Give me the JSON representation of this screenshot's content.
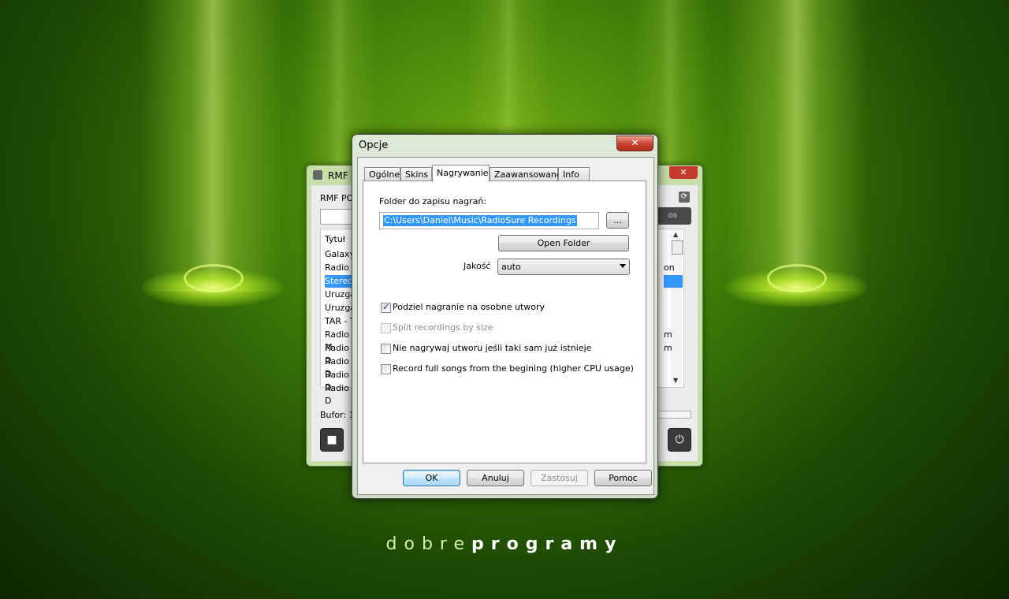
{
  "desktop": {
    "brand_light": "dobre",
    "brand_bold": "programy"
  },
  "bg_window": {
    "title": "RMF F",
    "top_label": "RMF POI",
    "list_header": "Tytuł",
    "rows": [
      "Galaxy",
      "Radio Y",
      "Stereo",
      "Uruzga",
      "Uruzga",
      "TAR - T",
      "Radio M",
      "Radio D",
      "Radio D",
      "Radio D",
      "Radio D"
    ],
    "row_tails": [
      "",
      "on",
      "",
      "",
      "",
      "",
      "m",
      "m",
      "",
      "",
      ""
    ],
    "selected_row": 2,
    "side_button": "os",
    "buffer_label": "Bufor: 1"
  },
  "dialog": {
    "title": "Opcje",
    "close_label": "x",
    "tabs": [
      "Ogólne",
      "Skins",
      "Nagrywanie",
      "Zaawansowane",
      "Info"
    ],
    "active_tab": 2,
    "folder_label": "Folder do zapisu nagrań:",
    "folder_value": "C:\\Users\\Daniel\\Music\\RadioSure Recordings",
    "browse_label": "...",
    "open_folder_label": "Open Folder",
    "quality_label": "Jakość",
    "quality_value": "auto",
    "checkboxes": [
      {
        "label": "Podziel nagranie na osobne utwory",
        "checked": true,
        "disabled": false
      },
      {
        "label": "Split recordings by size",
        "checked": false,
        "disabled": true
      },
      {
        "label": "Nie nagrywaj utworu jeśli taki sam już istnieje",
        "checked": false,
        "disabled": false
      },
      {
        "label": "Record full songs from the begining (higher CPU usage)",
        "checked": false,
        "disabled": false
      }
    ],
    "buttons": {
      "ok": "OK",
      "cancel": "Anuluj",
      "apply": "Zastosuj",
      "help": "Pomoc"
    }
  }
}
